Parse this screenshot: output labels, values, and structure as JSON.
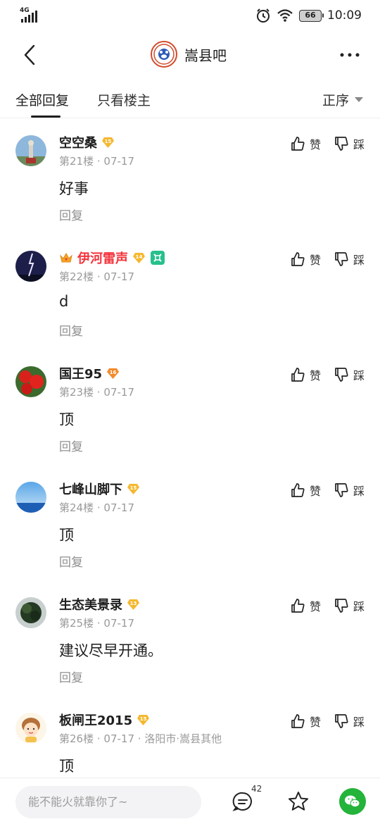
{
  "status_bar": {
    "network": "4G",
    "battery": "66",
    "time": "10:09"
  },
  "header": {
    "forum_name": "嵩县吧"
  },
  "tabs": [
    {
      "label": "全部回复"
    },
    {
      "label": "只看楼主"
    }
  ],
  "sort": {
    "label": "正序"
  },
  "actions": {
    "like": "赞",
    "dislike": "踩",
    "reply": "回复"
  },
  "posts": [
    {
      "username": "空空桑",
      "level": "15",
      "floor": "第21楼",
      "date": "07-17",
      "location": "",
      "content": "好事",
      "name_red": false,
      "crown": false
    },
    {
      "username": "伊河雷声",
      "level": "14",
      "floor": "第22楼",
      "date": "07-17",
      "location": "",
      "content": "d",
      "name_red": true,
      "crown": true
    },
    {
      "username": "国王95",
      "level": "16",
      "floor": "第23楼",
      "date": "07-17",
      "location": "",
      "content": "顶",
      "name_red": false,
      "crown": false
    },
    {
      "username": "七峰山脚下",
      "level": "15",
      "floor": "第24楼",
      "date": "07-17",
      "location": "",
      "content": "顶",
      "name_red": false,
      "crown": false
    },
    {
      "username": "生态美景录",
      "level": "13",
      "floor": "第25楼",
      "date": "07-17",
      "location": "",
      "content": "建议尽早开通。",
      "name_red": false,
      "crown": false
    },
    {
      "username": "板闸王2015",
      "level": "15",
      "floor": "第26楼",
      "date": "07-17",
      "location": "洛阳市·嵩县其他",
      "content": "顶",
      "name_red": false,
      "crown": false
    }
  ],
  "bottom_bar": {
    "placeholder": "能不能火就靠你了~",
    "comment_count": "42"
  },
  "colors": {
    "accent_red": "#f4333c",
    "wechat_green": "#24b33b",
    "level_gold": "#f5b82e",
    "level_orange": "#f28b2c"
  }
}
